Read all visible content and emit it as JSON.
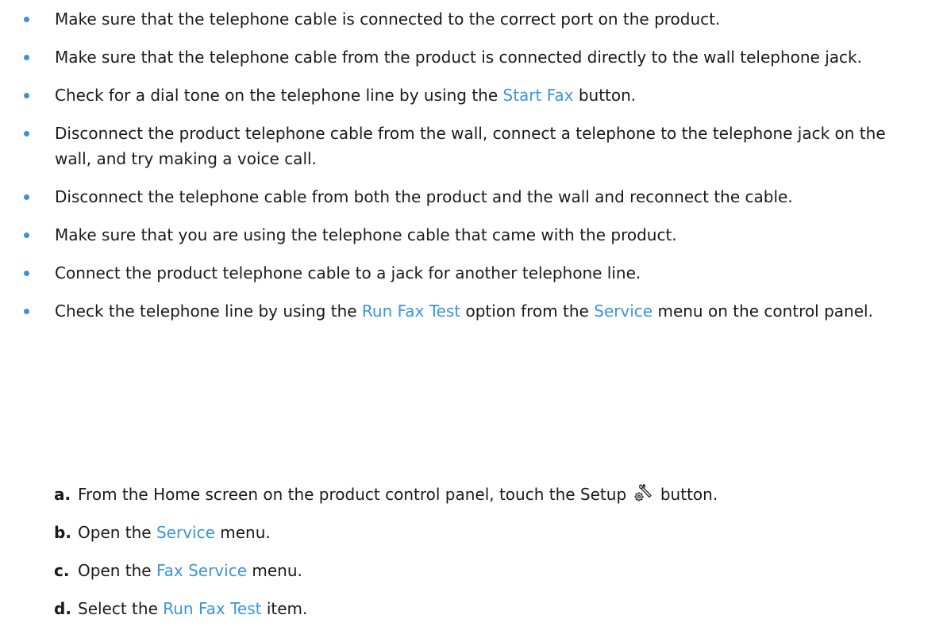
{
  "bullets": [
    {
      "parts": [
        "Make sure that the telephone cable is connected to the correct port on the product."
      ]
    },
    {
      "parts": [
        "Make sure that the telephone cable from the product is connected directly to the wall telephone jack."
      ]
    },
    {
      "before": "Check for a dial tone on the telephone line by using the ",
      "link": "Start Fax",
      "after": " button."
    },
    {
      "parts": [
        "Disconnect the product telephone cable from the wall, connect a telephone to the telephone jack on the wall, and try making a voice call."
      ]
    },
    {
      "parts": [
        "Disconnect the telephone cable from both the product and the wall and reconnect the cable."
      ]
    },
    {
      "parts": [
        "Make sure that you are using the telephone cable that came with the product."
      ]
    },
    {
      "parts": [
        "Connect the product telephone cable to a jack for another telephone line."
      ]
    },
    {
      "t1": "Check the telephone line by using the ",
      "link1": "Run Fax Test",
      "t2": " option from the ",
      "link2": "Service",
      "t3": " menu on the control panel."
    }
  ],
  "steps": [
    {
      "marker": "a.",
      "before": "From the Home screen on the product control panel, touch the Setup ",
      "icon": "setup-wrench-gear-icon",
      "after": " button."
    },
    {
      "marker": "b.",
      "before": "Open the ",
      "link": "Service",
      "after": " menu."
    },
    {
      "marker": "c.",
      "before": "Open the ",
      "link": "Fax Service",
      "after": " menu."
    },
    {
      "marker": "d.",
      "before": "Select the ",
      "link": "Run Fax Test",
      "after": " item."
    }
  ],
  "colors": {
    "link": "#3a95dd",
    "bullet": "#3c90d6",
    "text": "#1a1a1a"
  }
}
